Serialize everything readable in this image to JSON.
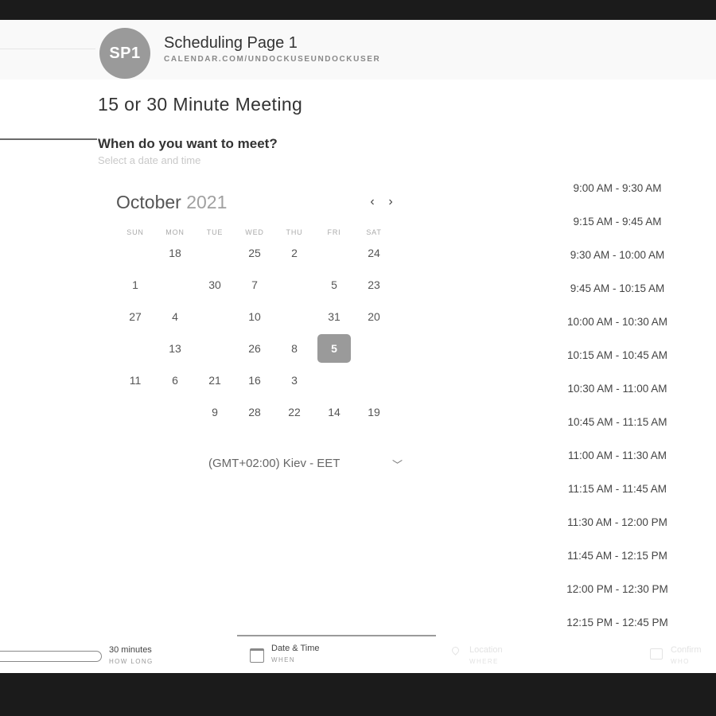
{
  "header": {
    "avatar_text": "SP1",
    "page_name": "Scheduling Page 1",
    "page_url": "CALENDAR.COM/UNDOCKUSEUNDOCKUSER"
  },
  "event": {
    "title": "15 or 30 Minute Meeting",
    "question": "When do you want to meet?",
    "subtitle": "Select a date and time"
  },
  "calendar": {
    "month": "October",
    "year": "2021",
    "prev_icon": "chevron-left-icon",
    "next_icon": "chevron-right-icon",
    "prev_glyph": "‹",
    "next_glyph": "›",
    "weekdays": [
      "SUN",
      "MON",
      "TUE",
      "WED",
      "THU",
      "FRI",
      "SAT"
    ],
    "weeks": [
      [
        {
          "d": "",
          "muted": true
        },
        {
          "d": "18"
        },
        {
          "d": "",
          "muted": true
        },
        {
          "d": "25"
        },
        {
          "d": "2"
        },
        {
          "d": "",
          "muted": true
        },
        {
          "d": "24"
        }
      ],
      [
        {
          "d": "1"
        },
        {
          "d": "",
          "muted": true
        },
        {
          "d": "30"
        },
        {
          "d": "7"
        },
        {
          "d": "",
          "muted": true
        },
        {
          "d": "5"
        },
        {
          "d": "23"
        }
      ],
      [
        {
          "d": "27"
        },
        {
          "d": "4"
        },
        {
          "d": "",
          "muted": true
        },
        {
          "d": "10"
        },
        {
          "d": "",
          "muted": true
        },
        {
          "d": "31"
        },
        {
          "d": "20"
        }
      ],
      [
        {
          "d": "",
          "muted": true
        },
        {
          "d": "13"
        },
        {
          "d": "",
          "muted": true
        },
        {
          "d": "26"
        },
        {
          "d": "8"
        },
        {
          "d": "5",
          "selected": true
        },
        {
          "d": "",
          "muted": true
        }
      ],
      [
        {
          "d": "11"
        },
        {
          "d": "6"
        },
        {
          "d": "21"
        },
        {
          "d": "16"
        },
        {
          "d": "3"
        },
        {
          "d": "",
          "muted": true
        },
        {
          "d": "",
          "muted": true
        }
      ],
      [
        {
          "d": "",
          "muted": true
        },
        {
          "d": "",
          "muted": true
        },
        {
          "d": "9"
        },
        {
          "d": "28"
        },
        {
          "d": "22"
        },
        {
          "d": "14"
        },
        {
          "d": "19"
        }
      ]
    ],
    "timezone": "(GMT+02:00) Kiev - EET",
    "timezone_icon": "chevron-down-icon",
    "timezone_glyph": "﹀"
  },
  "slots": [
    "9:00 AM - 9:30 AM",
    "9:15 AM - 9:45 AM",
    "9:30 AM - 10:00 AM",
    "9:45 AM - 10:15 AM",
    "10:00 AM - 10:30 AM",
    "10:15 AM - 10:45 AM",
    "10:30 AM - 11:00 AM",
    "10:45 AM - 11:15 AM",
    "11:00 AM - 11:30 AM",
    "11:15 AM - 11:45 AM",
    "11:30 AM - 12:00 PM",
    "11:45 AM - 12:15 PM",
    "12:00 PM - 12:30 PM",
    "12:15 PM - 12:45 PM"
  ],
  "footer": {
    "duration_label": "30 minutes",
    "duration_sub": "HOW LONG",
    "when_label": "Date & Time",
    "when_sub": "WHEN",
    "location_label": "Location",
    "location_sub": "WHERE",
    "confirm_label": "Confirm",
    "confirm_sub": "WHO",
    "icons": [
      "calendar-icon",
      "location-pin-icon",
      "confirm-icon"
    ]
  },
  "colors": {
    "background": "#1b1b1b",
    "page": "#ffffff",
    "accent": "#9a9a9a"
  }
}
